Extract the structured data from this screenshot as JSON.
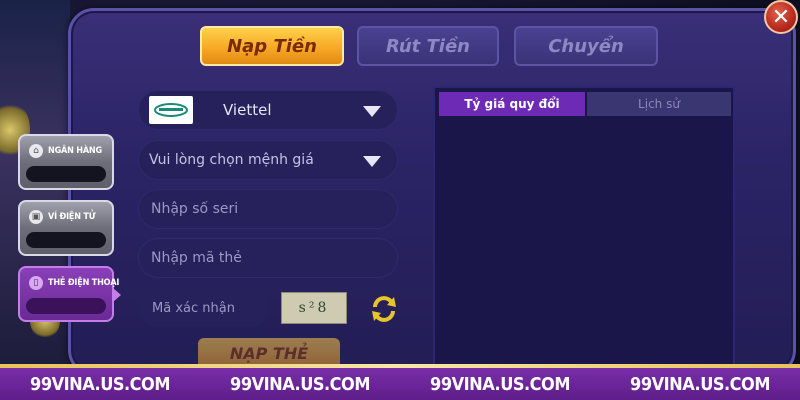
{
  "tabs": [
    {
      "label": "Nạp Tiền",
      "active": true
    },
    {
      "label": "Rút Tiền",
      "active": false
    },
    {
      "label": "Chuyển",
      "active": false
    }
  ],
  "side_tabs": [
    {
      "label": "NGÂN HÀNG",
      "icon": "bank-icon"
    },
    {
      "label": "VÍ ĐIỆN TỬ",
      "icon": "wallet-icon"
    },
    {
      "label": "THẺ ĐIỆN THOẠI",
      "icon": "phone-icon",
      "active": true
    }
  ],
  "form": {
    "carrier_value": "Viettel",
    "denomination_value": "Vui lòng chọn mệnh giá",
    "serial_placeholder": "Nhập số seri",
    "code_placeholder": "Nhập mã thẻ",
    "captcha_placeholder": "Mã xác nhận",
    "captcha_text": "s²8",
    "submit_label": "NẠP THẺ"
  },
  "rate_panel": {
    "tab_rate": "Tỷ giá quy đổi",
    "tab_history": "Lịch sử"
  },
  "footer": {
    "urls": [
      "99VINA.US.COM",
      "99VINA.US.COM",
      "99VINA.US.COM",
      "99VINA.US.COM"
    ]
  },
  "colors": {
    "accent": "#f5a623",
    "panel": "#2b2466",
    "footer": "#6a2496",
    "active_side": "#6a2a96"
  }
}
